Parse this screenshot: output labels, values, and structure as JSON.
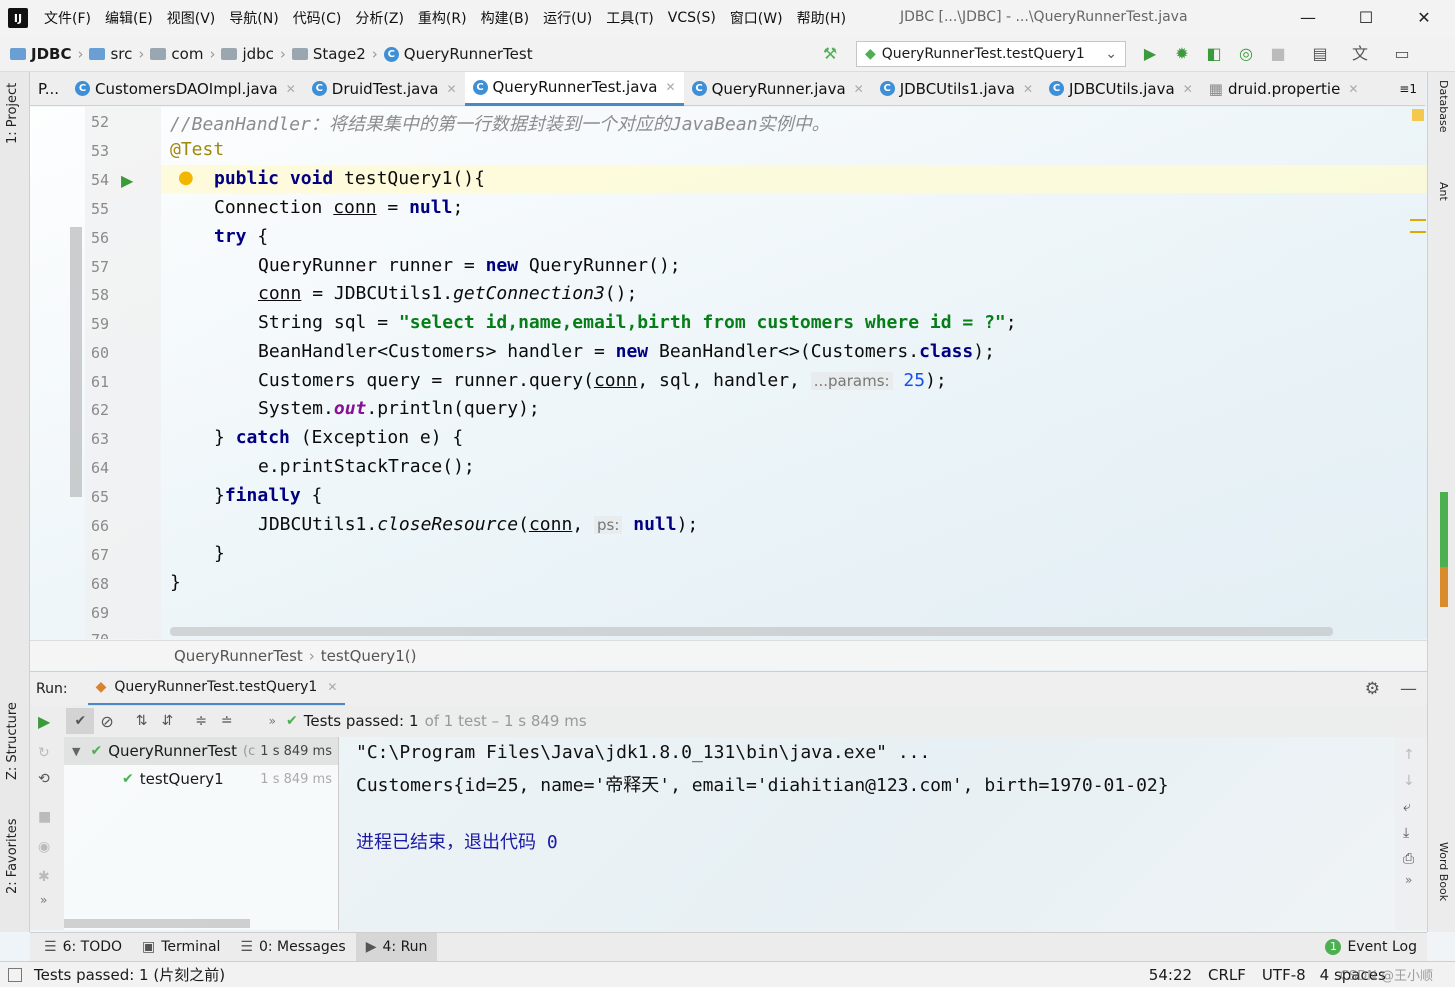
{
  "menubar": {
    "logo": "IJ",
    "items": [
      "文件(F)",
      "编辑(E)",
      "视图(V)",
      "导航(N)",
      "代码(C)",
      "分析(Z)",
      "重构(R)",
      "构建(B)",
      "运行(U)",
      "工具(T)",
      "VCS(S)",
      "窗口(W)",
      "帮助(H)"
    ],
    "window_title": "JDBC [...\\JDBC] - ...\\QueryRunnerTest.java",
    "minimize": "—",
    "maximize": "☐",
    "close": "✕"
  },
  "navbar": {
    "crumbs": [
      "JDBC",
      "src",
      "com",
      "jdbc",
      "Stage2",
      "QueryRunnerTest"
    ],
    "run_config": "QueryRunnerTest.testQuery1"
  },
  "tabs": [
    {
      "label": "P..."
    },
    {
      "label": "CustomersDAOImpl.java"
    },
    {
      "label": "DruidTest.java"
    },
    {
      "label": "QueryRunnerTest.java"
    },
    {
      "label": "QueryRunner.java"
    },
    {
      "label": "JDBCUtils1.java"
    },
    {
      "label": "JDBCUtils.java"
    },
    {
      "label": "druid.propertie"
    }
  ],
  "tabs_overflow": "≡1",
  "left_strip": {
    "project": "1: Project",
    "structure": "Z: Structure",
    "favorites": "2: Favorites"
  },
  "right_strip": {
    "database": "Database",
    "ant": "Ant",
    "wordbook": "Word Book"
  },
  "editor": {
    "line_numbers": [
      "52",
      "53",
      "54",
      "55",
      "56",
      "57",
      "58",
      "59",
      "60",
      "61",
      "62",
      "63",
      "64",
      "65",
      "66",
      "67",
      "68",
      "69",
      "70"
    ],
    "lines": {
      "l52_comment": "//BeanHandler：将结果集中的第一行数据封装到一个对应的JavaBean实例中。",
      "l53_annotation": "@Test",
      "l54_kw": "public void",
      "l54_rest": " testQuery1(){",
      "l55_a": "Connection ",
      "l55_b": "conn",
      "l55_c": " = ",
      "l55_d": "null",
      "l55_e": ";",
      "l56_kw": "try",
      "l56_rest": " {",
      "l57_a": "QueryRunner runner = ",
      "l57_kw": "new",
      "l57_b": " QueryRunner();",
      "l58_a": "conn",
      "l58_b": " = JDBCUtils1.",
      "l58_c": "getConnection3",
      "l58_d": "();",
      "l59_a": "String sql = ",
      "l59_str": "\"select id,name,email,birth from customers where id = ?\"",
      "l59_b": ";",
      "l60_a": "BeanHandler<Customers> handler = ",
      "l60_kw": "new",
      "l60_b": " BeanHandler<>(Customers.",
      "l60_kw2": "class",
      "l60_c": ");",
      "l61_a": "Customers query = runner.query(",
      "l61_b": "conn",
      "l61_c": ", sql, handler, ",
      "l61_hint": "...params:",
      "l61_num": "25",
      "l61_d": ");",
      "l62_a": "System.",
      "l62_fld": "out",
      "l62_b": ".println(query);",
      "l63_a": "} ",
      "l63_kw": "catch",
      "l63_b": " (Exception e) {",
      "l64": "e.printStackTrace();",
      "l65_a": "}",
      "l65_kw": "finally",
      "l65_b": " {",
      "l66_a": "JDBCUtils1.",
      "l66_b": "closeResource",
      "l66_c": "(",
      "l66_d": "conn",
      "l66_e": ", ",
      "l66_hint": "ps:",
      "l66_kw": "null",
      "l66_f": ");",
      "l67": "}",
      "l68": "}"
    }
  },
  "editor_breadcrumb": [
    "QueryRunnerTest",
    "testQuery1()"
  ],
  "run": {
    "label": "Run:",
    "tab": "QueryRunnerTest.testQuery1",
    "status_prefix": "Tests passed:",
    "status_count": "1",
    "status_detail": "of 1 test – 1 s 849 ms",
    "tree": [
      {
        "name": "QueryRunnerTest",
        "suffix": "(c",
        "time": "1 s 849 ms"
      },
      {
        "name": "testQuery1",
        "time": "1 s 849 ms"
      }
    ],
    "console": [
      "\"C:\\Program Files\\Java\\jdk1.8.0_131\\bin\\java.exe\" ...",
      "Customers{id=25, name='帝释天', email='diahitian@123.com', birth=1970-01-02}",
      "",
      "进程已结束，退出代码 0"
    ]
  },
  "tooltabs": [
    {
      "label": "6: TODO",
      "icon": "list-icon"
    },
    {
      "label": "Terminal",
      "icon": "terminal-icon"
    },
    {
      "label": "0: Messages",
      "icon": "messages-icon"
    },
    {
      "label": "4: Run",
      "icon": "run-icon"
    }
  ],
  "event_log": {
    "count": "1",
    "label": "Event Log"
  },
  "status": {
    "message": "Tests passed: 1 (片刻之前)",
    "position": "54:22",
    "line_sep": "CRLF",
    "encoding": "UTF-8",
    "indent": "4 spaces",
    "watermark": "CSDN @王小顺"
  },
  "colors": {
    "keyword": "#000080",
    "string": "#067d17",
    "comment": "#8c8c8c",
    "accent": "#4a88c7",
    "pass": "#4caf50"
  }
}
